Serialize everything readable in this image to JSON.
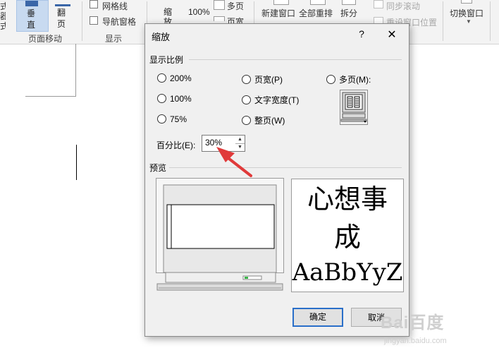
{
  "ribbon": {
    "left_cut": "式\n器\n式",
    "vertical_label": "垂\n直",
    "flip_label": "翻\n页",
    "page_move_group": "页面移动",
    "gridlines_label": "网格线",
    "navpane_label": "导航窗格",
    "show_group": "显示",
    "zoom_label": "缩\n放",
    "hundred_label": "100%",
    "multipage_label": "多页",
    "pagewidth_label": "页宽",
    "new_window_label": "新建窗口",
    "arrange_all_label": "全部重排",
    "split_label": "拆分",
    "sync_scroll_label": "同步滚动",
    "reset_pos_label": "重设窗口位置",
    "switch_window_label": "切换窗口"
  },
  "dialog": {
    "title": "缩放",
    "help": "?",
    "close": "✕",
    "zoom_group_title": "显示比例",
    "options": {
      "p200": "200%",
      "p100": "100%",
      "p75": "75%",
      "page_width": "页宽(P)",
      "text_width": "文字宽度(T)",
      "whole_page": "整页(W)",
      "many_pages": "多页(M):"
    },
    "percent_label": "百分比(E):",
    "percent_value": "30%",
    "preview_group_title": "预览",
    "preview_text_line1": "心想事",
    "preview_text_line2": "成",
    "preview_text_line3": "AaBbYyZ",
    "ok": "确定",
    "cancel": "取消"
  },
  "watermark": {
    "logo": "Bai百度",
    "url": "jingyan.baidu.com"
  },
  "colors": {
    "arrow": "#e03a3a",
    "ok_border": "#2a6fc9",
    "ribbon_bg": "#f3f3f3"
  }
}
